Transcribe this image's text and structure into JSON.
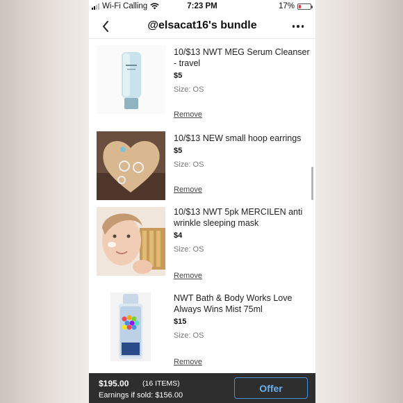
{
  "status_bar": {
    "carrier": "Wi-Fi Calling",
    "time": "7:23 PM",
    "battery": "17%",
    "battery_level": 0.17
  },
  "header": {
    "title": "@elsacat16's bundle",
    "back_icon": "chevron-left-icon",
    "more_icon": "more-horizontal-icon"
  },
  "items": [
    {
      "title": "10/$13 NWT MEG Serum Cleanser - travel",
      "price": "$5",
      "size": "Size: OS",
      "remove_label": "Remove",
      "image": "serum-tube"
    },
    {
      "title": "10/$13 NEW small hoop earrings",
      "price": "$5",
      "size": "Size: OS",
      "remove_label": "Remove",
      "image": "earrings-heart"
    },
    {
      "title": "10/$13 NWT 5pk MERCILEN anti wrinkle sleeping mask",
      "price": "$4",
      "size": "Size: OS",
      "remove_label": "Remove",
      "image": "face-mask"
    },
    {
      "title": "NWT Bath & Body Works Love Always Wins Mist 75ml",
      "price": "$15",
      "size": "Size: OS",
      "remove_label": "Remove",
      "image": "mist-bottle"
    }
  ],
  "footer": {
    "total": "$195.00",
    "items_count": "(16 ITEMS)",
    "earnings": "Earnings if sold: $156.00",
    "offer_label": "Offer"
  },
  "colors": {
    "bottom_bar": "#2e2e2e",
    "offer_accent": "#4a90d9",
    "battery_low": "#e03a3a"
  }
}
